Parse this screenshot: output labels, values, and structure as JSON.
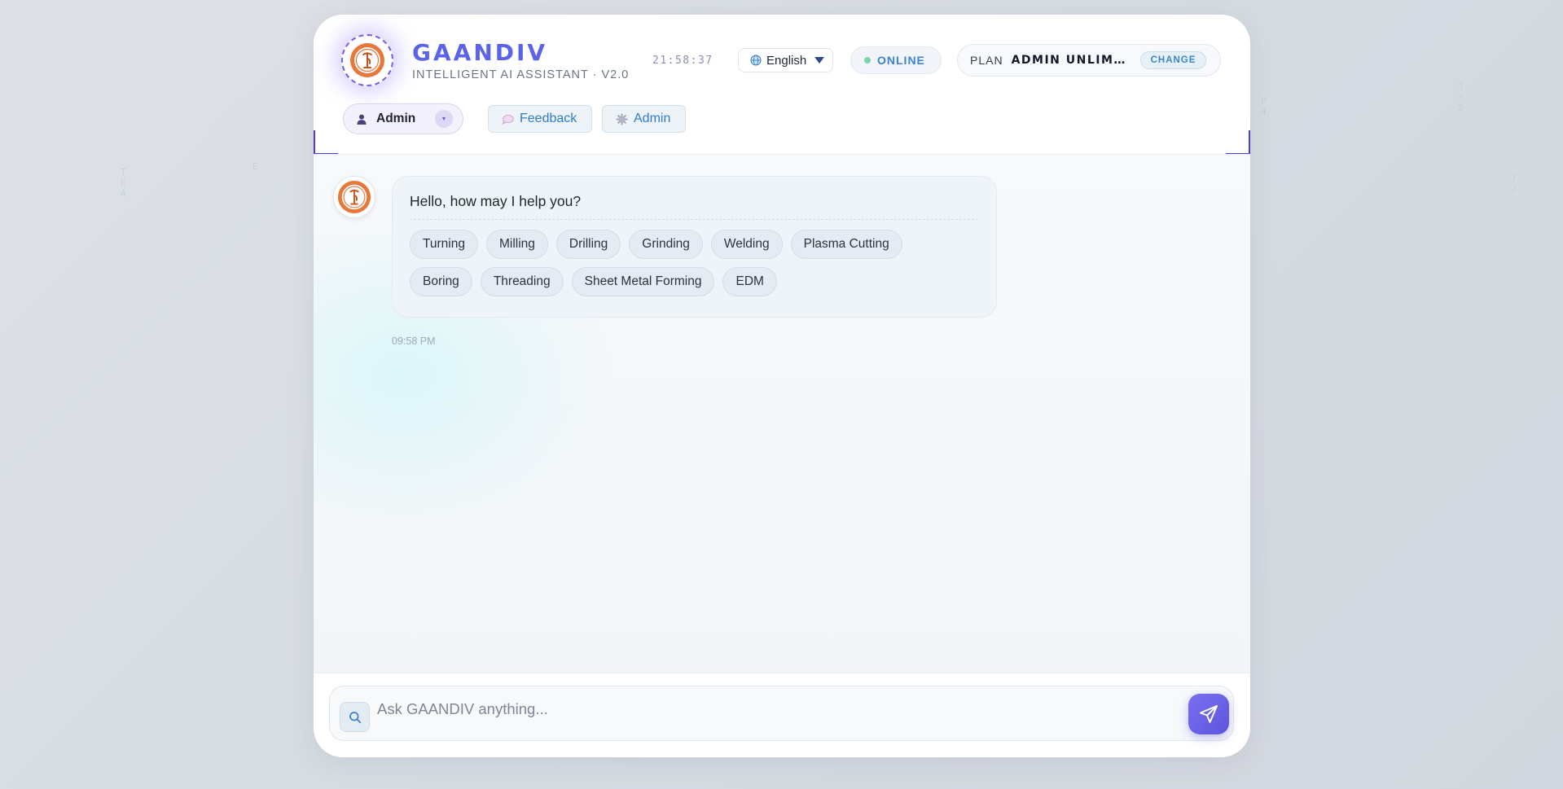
{
  "header": {
    "brand_title": "GAANDIV",
    "brand_subtitle": "INTELLIGENT AI ASSISTANT · V2.0",
    "clock": "21:58:37",
    "language": {
      "selected": "English",
      "icon": "globe-icon"
    },
    "status": {
      "label": "ONLINE",
      "color": "#7fd4a8"
    },
    "plan": {
      "label": "PLAN",
      "value": "ADMIN UNLIMITED",
      "change_label": "CHANGE"
    },
    "user": {
      "name": "Admin",
      "icon": "user-icon"
    },
    "nav": [
      {
        "label": "Feedback",
        "icon": "speech-bubble-icon"
      },
      {
        "label": "Admin",
        "icon": "gear-icon"
      }
    ]
  },
  "chat": {
    "messages": [
      {
        "sender": "bot",
        "text": "Hello, how may I help you?",
        "time": "09:58 PM",
        "suggestions": [
          [
            "Turning",
            "Milling",
            "Drilling",
            "Grinding",
            "Welding",
            "Plasma Cutting"
          ],
          [
            "Boring",
            "Threading",
            "Sheet Metal Forming",
            "EDM"
          ]
        ]
      }
    ]
  },
  "input": {
    "placeholder": "Ask GAANDIV anything...",
    "value": ""
  },
  "colors": {
    "accent": "#5b63e8",
    "link": "#2f7bd0",
    "send_button": "#6a62e6"
  }
}
